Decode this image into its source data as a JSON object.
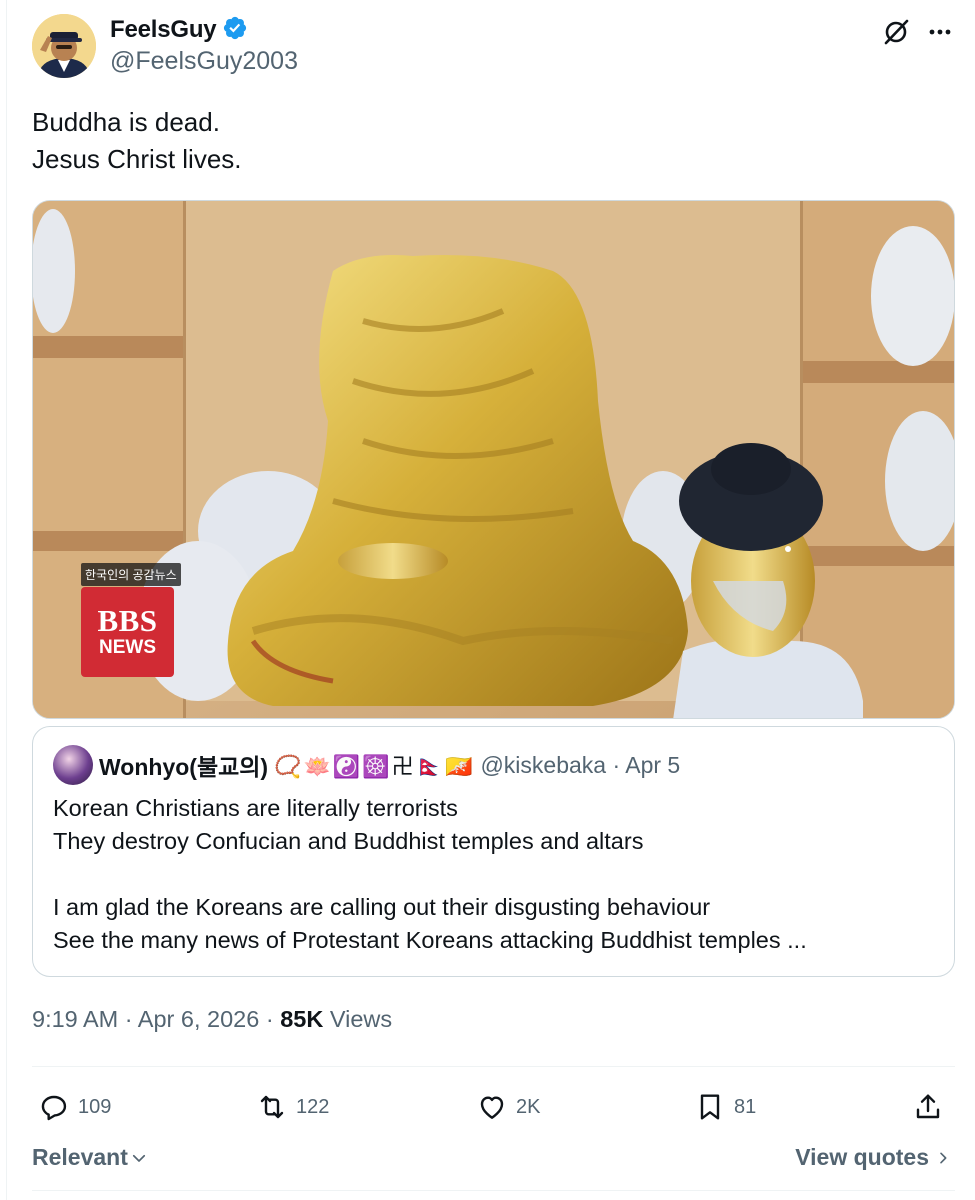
{
  "author": {
    "display_name": "FeelsGuy",
    "handle": "@FeelsGuy2003",
    "verified": true,
    "icons": {
      "verified": "verified-badge-icon",
      "grok": "grok-icon",
      "more": "more-icon"
    }
  },
  "tweet": {
    "lines": [
      "Buddha is dead.",
      "Jesus Christ lives."
    ],
    "timestamp": "9:19 AM · Apr 6, 2026 · ",
    "views_count": "85K",
    "views_label": " Views"
  },
  "media": {
    "overlay_tag": "한국인의 공감뉴스",
    "logo_main": "BBS",
    "logo_sub": "NEWS"
  },
  "quote": {
    "display_name": "Wonhyo(불교의)",
    "emojis": "📿🪷☯️☸️卍🇳🇵🇧🇹",
    "handle": "@kiskebaka · Apr 5",
    "lines": [
      "Korean Christians are literally terrorists",
      "They destroy Confucian and Buddhist temples and altars",
      "",
      "I am glad the Koreans are calling out their disgusting behaviour",
      "See the many news of Protestant Koreans attacking Buddhist temples ..."
    ]
  },
  "actions": {
    "replies": "109",
    "reposts": "122",
    "likes": "2K",
    "bookmarks": "81",
    "icons": [
      "reply-icon",
      "repost-icon",
      "like-icon",
      "bookmark-icon",
      "share-icon"
    ]
  },
  "footer": {
    "sort_label": "Relevant",
    "view_quotes": "View quotes"
  },
  "colors": {
    "text_primary": "#0f1419",
    "text_secondary": "#536471",
    "verified_blue": "#1d9bf0",
    "border": "#cfd9de",
    "divider": "#eff3f4",
    "bbs_red": "#d12b34"
  }
}
